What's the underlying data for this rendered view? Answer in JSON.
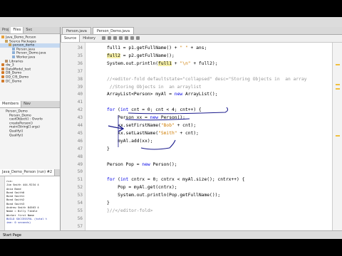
{
  "projects_panel": {
    "tabs": [
      "Proj",
      "Files",
      "Svc"
    ],
    "tree": [
      {
        "text": "Java_Demo_Person",
        "indent": 0,
        "icon": "proj"
      },
      {
        "text": "Source Packages",
        "indent": 1,
        "icon": "pkg"
      },
      {
        "text": "person_demo",
        "indent": 2,
        "icon": "pkg",
        "selected": true
      },
      {
        "text": "Person.java",
        "indent": 3,
        "icon": "file"
      },
      {
        "text": "Person_Demo.java",
        "indent": 3,
        "icon": "file"
      },
      {
        "text": "Worker.java",
        "indent": 3,
        "icon": "file"
      },
      {
        "text": "Libraries",
        "indent": 1,
        "icon": "lib"
      },
      {
        "text": "dw_3",
        "indent": 0,
        "icon": "cup"
      },
      {
        "text": "DataModel_test",
        "indent": 0,
        "icon": "cup"
      },
      {
        "text": "DB_Demo",
        "indent": 0,
        "icon": "cup"
      },
      {
        "text": "DD_CIS_Demo",
        "indent": 0,
        "icon": "cup"
      },
      {
        "text": "DC_Demo",
        "indent": 0,
        "icon": "cup"
      }
    ]
  },
  "navigator_panel": {
    "tabs": [
      "Members",
      "Nav"
    ],
    "items": [
      "Person_Demo",
      "Person_Demo",
      "castObject() : Overlo",
      "createPerson()",
      "main(String[] args)",
      "Qualify()",
      "Qualify()"
    ]
  },
  "output_panel": {
    "tab": "Java_Demo_Person (run) #2",
    "lines": [
      {
        "text": "run:",
        "blue": false
      },
      {
        "text": "Jim Smith 444-9234 4",
        "blue": false
      },
      {
        "text": "Ania Bond",
        "blue": false
      },
      {
        "text": "Bond Smith0",
        "blue": false
      },
      {
        "text": "Bond Smith1",
        "blue": false
      },
      {
        "text": "Bond Smith2",
        "blue": false
      },
      {
        "text": "Bond Smith3",
        "blue": false
      },
      {
        "text": "Andrew Smith 84563 4",
        "blue": false
      },
      {
        "text": "Name = Billy Tibble",
        "blue": false
      },
      {
        "text": "Worker first Name",
        "blue": false
      },
      {
        "text": "BUILD SUCCESSFUL (total t",
        "blue": true
      },
      {
        "text": "ime: 0 seconds)",
        "blue": true
      }
    ]
  },
  "editor": {
    "tabs": [
      "Person.java",
      "Person_Demo.java"
    ],
    "active_tab": 1,
    "subtabs": [
      "Source",
      "History"
    ],
    "line_numbers": [
      "34",
      "35",
      "36",
      "37",
      "38",
      "39",
      "40",
      "41",
      "42",
      "43",
      "44",
      "45",
      "46",
      "47",
      "48",
      "49",
      "50",
      "51",
      "52",
      "53",
      "54",
      "55",
      "56",
      "57"
    ],
    "code_lines": [
      {
        "row": 0,
        "indent": 8,
        "parts": [
          [
            "t",
            "full1 = p1.getFullName() + "
          ],
          [
            "s",
            "\" \""
          ],
          [
            "t",
            " + ans;"
          ]
        ]
      },
      {
        "row": 1,
        "indent": 8,
        "parts": [
          [
            "h",
            "full2"
          ],
          [
            "t",
            " = p2.getFullName();"
          ]
        ]
      },
      {
        "row": 2,
        "indent": 8,
        "parts": [
          [
            "t",
            "System.out.println("
          ],
          [
            "h",
            "full1"
          ],
          [
            "t",
            " + "
          ],
          [
            "s",
            "\"\\n\""
          ],
          [
            "t",
            " + full2);"
          ]
        ]
      },
      {
        "row": 4,
        "indent": 8,
        "parts": [
          [
            "c",
            "//<editor-fold defaultstate=\"collapsed\" desc=\"Storing Objects in  an array"
          ]
        ]
      },
      {
        "row": 5,
        "indent": 8,
        "parts": [
          [
            "c",
            " //Storing Objects in  an arraylist"
          ]
        ]
      },
      {
        "row": 6,
        "indent": 8,
        "parts": [
          [
            "t",
            "ArrayList<Person> myAl = "
          ],
          [
            "k",
            "new"
          ],
          [
            "t",
            " ArrayList();"
          ]
        ]
      },
      {
        "row": 8,
        "indent": 8,
        "parts": [
          [
            "k",
            "for"
          ],
          [
            "t",
            " ("
          ],
          [
            "k",
            "int"
          ],
          [
            "t",
            " cnt = 0; cnt < 4; cnt++) {"
          ]
        ]
      },
      {
        "row": 9,
        "indent": 12,
        "parts": [
          [
            "t",
            "Person xx = "
          ],
          [
            "k",
            "new"
          ],
          [
            "t",
            " Person();"
          ]
        ]
      },
      {
        "row": 10,
        "indent": 12,
        "parts": [
          [
            "t",
            "xx.setFirstName("
          ],
          [
            "s",
            "\"Bob\""
          ],
          [
            "t",
            " + cnt);"
          ]
        ]
      },
      {
        "row": 11,
        "indent": 12,
        "parts": [
          [
            "t",
            "xx.setLastName("
          ],
          [
            "s",
            "\"Smith\""
          ],
          [
            "t",
            " + cnt);"
          ]
        ]
      },
      {
        "row": 12,
        "indent": 12,
        "parts": [
          [
            "t",
            "myAl.add(xx);"
          ]
        ]
      },
      {
        "row": 13,
        "indent": 8,
        "parts": [
          [
            "t",
            "}"
          ]
        ]
      },
      {
        "row": 15,
        "indent": 8,
        "parts": [
          [
            "t",
            "Person Pop = "
          ],
          [
            "k",
            "new"
          ],
          [
            "t",
            " Person();"
          ]
        ]
      },
      {
        "row": 17,
        "indent": 8,
        "parts": [
          [
            "k",
            "for"
          ],
          [
            "t",
            " ("
          ],
          [
            "k",
            "int"
          ],
          [
            "t",
            " cntrx = 0; cntrx < myAl.size(); cntrx++) {"
          ]
        ]
      },
      {
        "row": 18,
        "indent": 12,
        "parts": [
          [
            "t",
            "Pop = myAl.get(cntrx);"
          ]
        ]
      },
      {
        "row": 19,
        "indent": 12,
        "parts": [
          [
            "t",
            "System.out.println(Pop.getFullName());"
          ]
        ]
      },
      {
        "row": 20,
        "indent": 8,
        "parts": [
          [
            "t",
            "}"
          ]
        ]
      },
      {
        "row": 21,
        "indent": 8,
        "parts": [
          [
            "c",
            "}//</editor-fold>"
          ]
        ]
      }
    ]
  },
  "status_bar": {
    "text": "Start Page"
  },
  "colors": {
    "keyword": "#0000e6",
    "string": "#ce7b00",
    "comment": "#969696",
    "ink": "#1a1a8c"
  }
}
